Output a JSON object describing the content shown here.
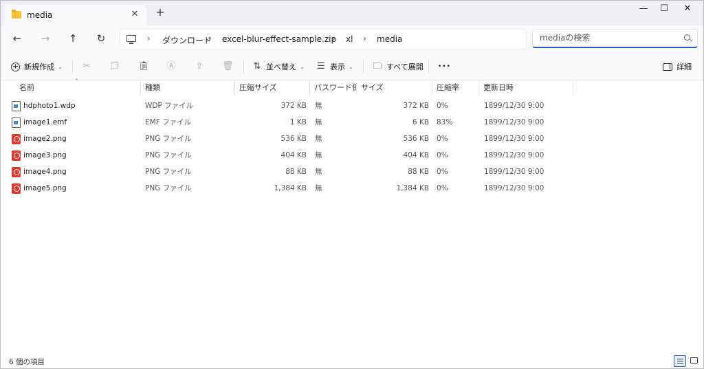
{
  "tab": {
    "title": "media",
    "close": "✕",
    "new": "+"
  },
  "window_controls": {
    "minimize": "—",
    "maximize": "☐",
    "close": "✕"
  },
  "nav": {
    "back": "←",
    "forward": "→",
    "up": "↑",
    "refresh": "↻"
  },
  "breadcrumb": [
    "ダウンロード",
    "excel-blur-effect-sample.zip",
    "xl",
    "media"
  ],
  "search": {
    "placeholder": "mediaの検索"
  },
  "toolbar": {
    "new": "新規作成",
    "sort": "並べ替え",
    "view": "表示",
    "expand_all": "すべて展開",
    "more": "•••",
    "details": "詳細"
  },
  "columns": [
    "名前",
    "種類",
    "圧縮サイズ",
    "パスワード保...",
    "サイズ",
    "圧縮率",
    "更新日時"
  ],
  "files": [
    {
      "name": "hdphoto1.wdp",
      "type": "WDP ファイル",
      "packed": "372 KB",
      "password": "無",
      "size": "372 KB",
      "ratio": "0%",
      "modified": "1899/12/30 9:00",
      "icon": "document-icon"
    },
    {
      "name": "image1.emf",
      "type": "EMF ファイル",
      "packed": "1 KB",
      "password": "無",
      "size": "6 KB",
      "ratio": "83%",
      "modified": "1899/12/30 9:00",
      "icon": "document-icon"
    },
    {
      "name": "image2.png",
      "type": "PNG ファイル",
      "packed": "536 KB",
      "password": "無",
      "size": "536 KB",
      "ratio": "0%",
      "modified": "1899/12/30 9:00",
      "icon": "png-icon"
    },
    {
      "name": "image3.png",
      "type": "PNG ファイル",
      "packed": "404 KB",
      "password": "無",
      "size": "404 KB",
      "ratio": "0%",
      "modified": "1899/12/30 9:00",
      "icon": "png-icon"
    },
    {
      "name": "image4.png",
      "type": "PNG ファイル",
      "packed": "88 KB",
      "password": "無",
      "size": "88 KB",
      "ratio": "0%",
      "modified": "1899/12/30 9:00",
      "icon": "png-icon"
    },
    {
      "name": "image5.png",
      "type": "PNG ファイル",
      "packed": "1,384 KB",
      "password": "無",
      "size": "1,384 KB",
      "ratio": "0%",
      "modified": "1899/12/30 9:00",
      "icon": "png-icon"
    }
  ],
  "status": {
    "count": "6 個の項目"
  },
  "colors": {
    "accent": "#1f5fbf",
    "folder": "#f8c235",
    "png": "#e0392b"
  }
}
